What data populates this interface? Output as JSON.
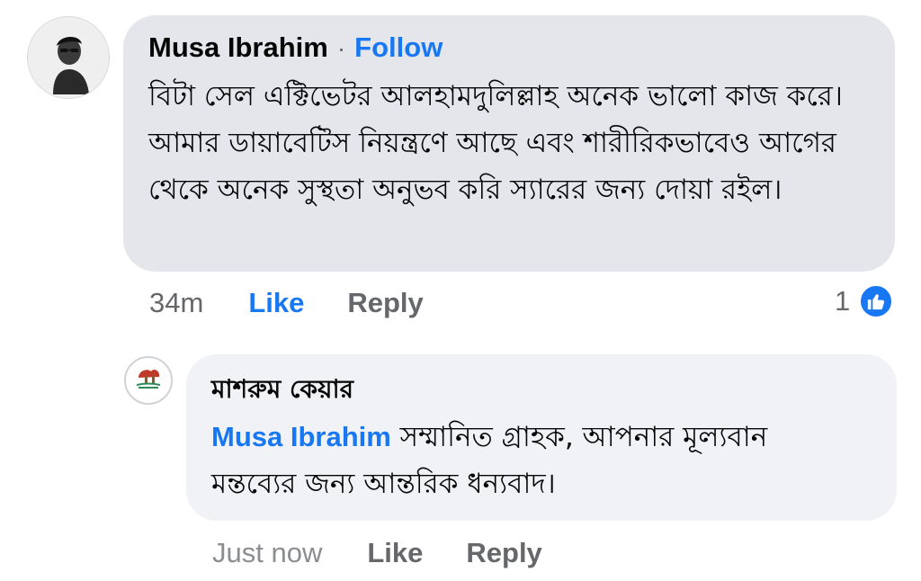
{
  "comment": {
    "author": "Musa Ibrahim",
    "separator": "·",
    "follow_label": "Follow",
    "text": "বিটা সেল এক্টিভেটর আলহামদুলিল্লাহ অনেক ভালো কাজ করে। আমার ডায়াবেটিস নিয়ন্ত্রণে আছে এবং শারীরিকভাবেও আগের থেকে অনেক সুস্থতা অনুভব করি স্যারের জন্য দোয়া রইল।",
    "time": "34m",
    "like_label": "Like",
    "reply_label": "Reply",
    "reaction_count": "1",
    "reaction_icon": "like-icon",
    "accent_color": "#1877f2"
  },
  "reply": {
    "author": "মাশরুম কেয়ার",
    "mention": "Musa Ibrahim",
    "text": " সম্মানিত গ্রাহক, আপনার মূল্যবান মন্তব্যের জন্য আন্তরিক ধন্যবাদ।",
    "time": "Just now",
    "like_label": "Like",
    "reply_label": "Reply"
  }
}
